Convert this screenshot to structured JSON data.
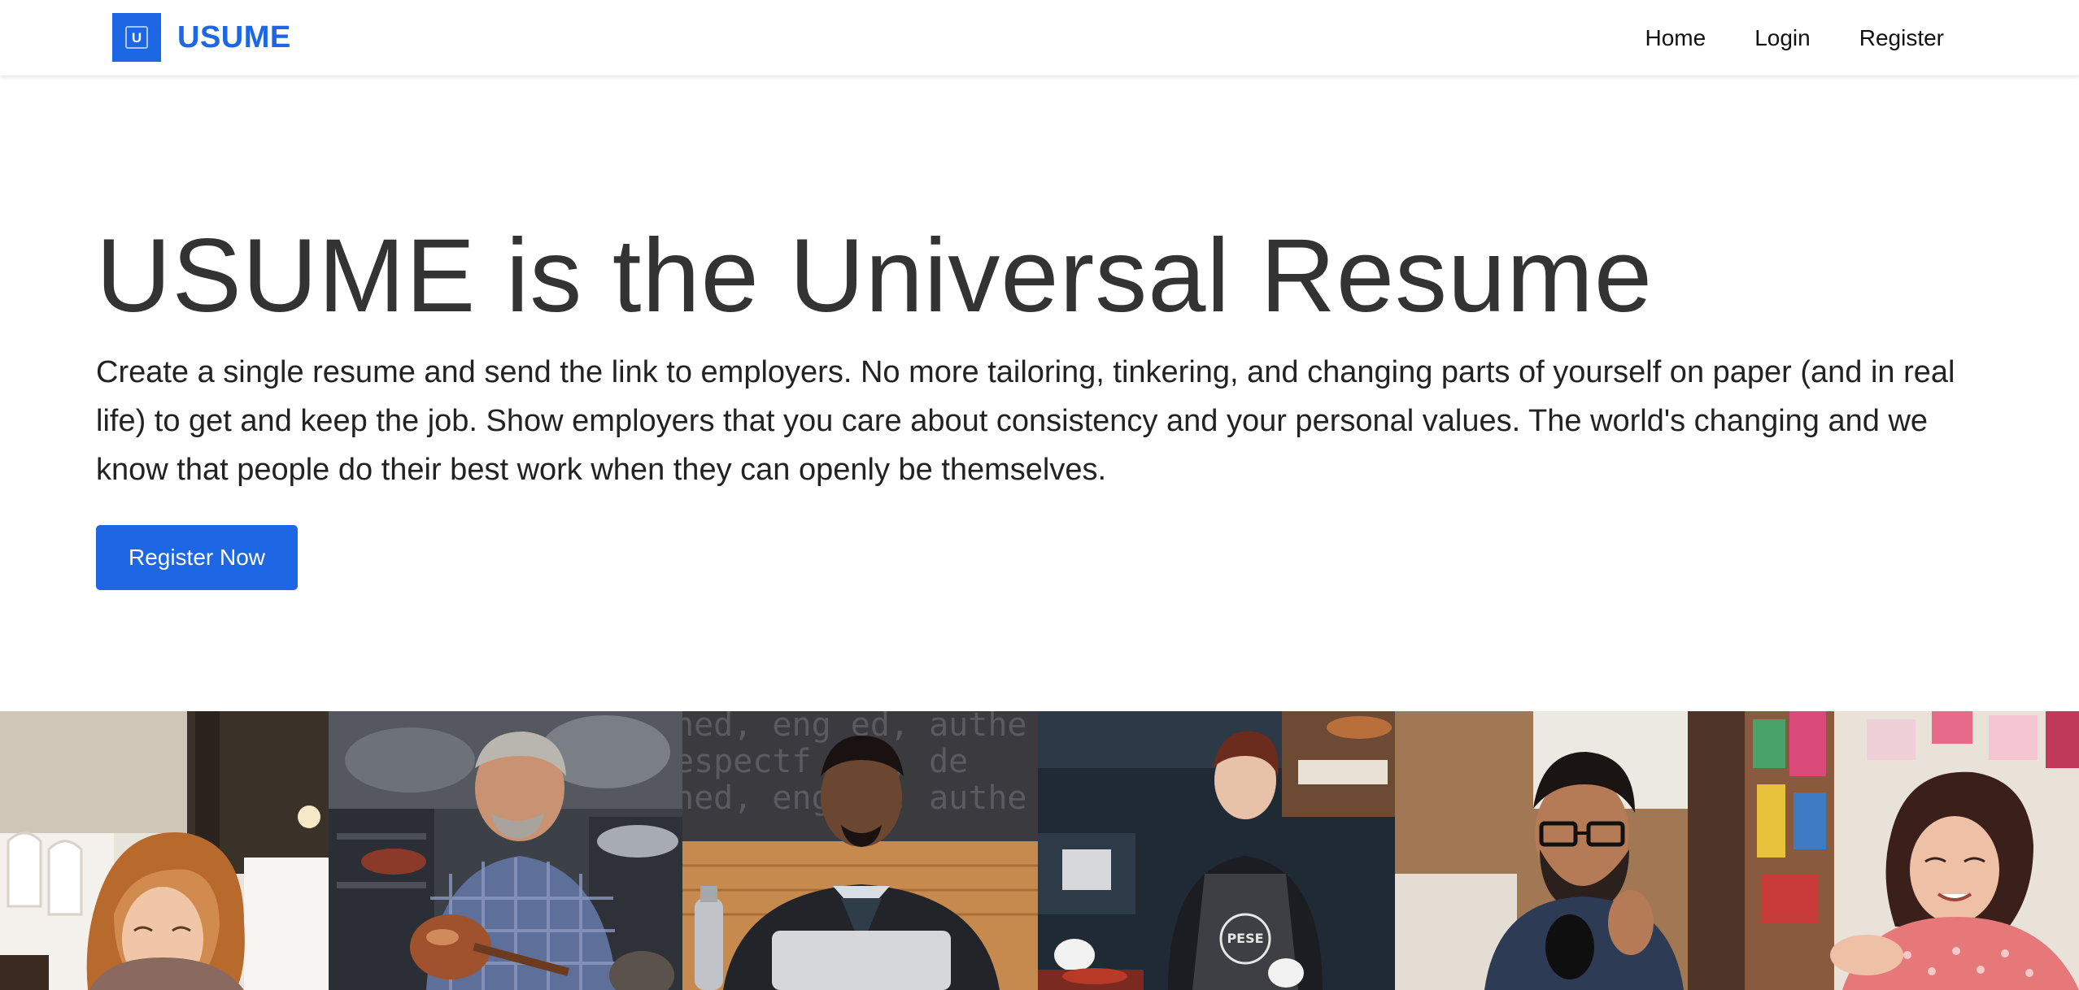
{
  "brand": {
    "logo_letter": "U",
    "name": "USUME",
    "color": "#1d66e4"
  },
  "nav": {
    "items": [
      "Home",
      "Login",
      "Register"
    ]
  },
  "hero": {
    "title": "USUME is the Universal Resume",
    "lead": "Create a single resume and send the link to employers. No more tailoring, tinkering, and changing parts of yourself on paper (and in real life) to get and keep the job. Show employers that you care about consistency and your personal values. The world's changing and we know that people do their best work when they can openly be themselves.",
    "cta_label": "Register Now"
  },
  "photos": [
    {
      "name": "woman-smiling-photo"
    },
    {
      "name": "man-craftsman-photo"
    },
    {
      "name": "man-laptop-photo"
    },
    {
      "name": "woman-apron-photo",
      "apron_logo": "PESE"
    },
    {
      "name": "man-glasses-photo"
    },
    {
      "name": "woman-shop-photo"
    }
  ]
}
